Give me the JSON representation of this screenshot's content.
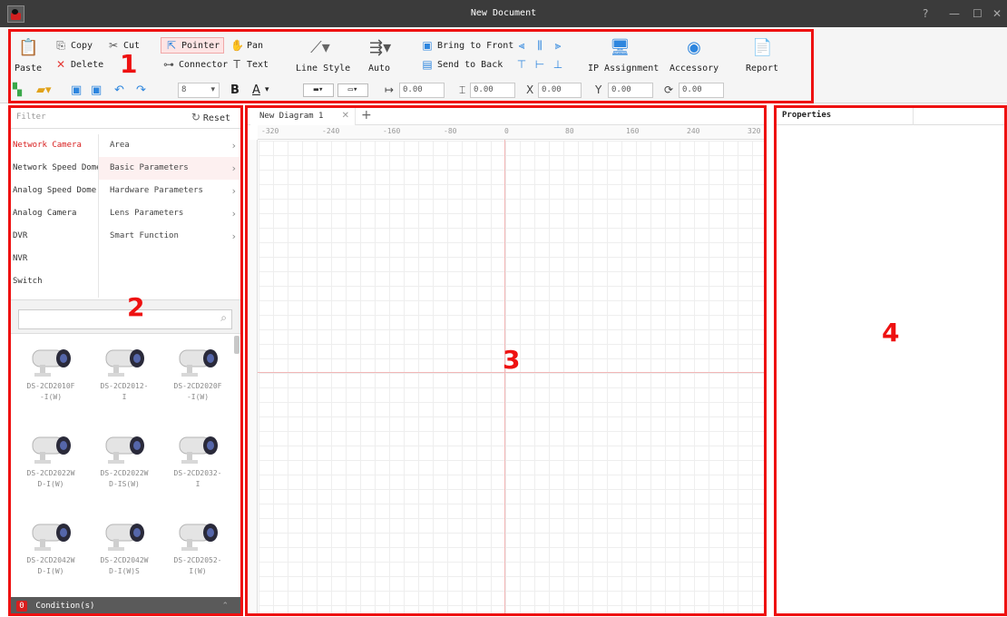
{
  "window": {
    "title": "New Document",
    "controls": [
      "?",
      "—",
      "☐",
      "✕"
    ]
  },
  "toolbar": {
    "paste": "Paste",
    "copy": "Copy",
    "cut": "Cut",
    "delete": "Delete",
    "pointer": "Pointer",
    "pan": "Pan",
    "connector": "Connector",
    "text": "Text",
    "line_style": "Line Style",
    "auto": "Auto",
    "bring_to_front": "Bring to Front",
    "send_to_back": "Send to Back",
    "ip_assignment": "IP Assignment",
    "accessory": "Accessory",
    "report": "Report",
    "font_size": "8",
    "bold": "B",
    "font_color": "A",
    "width_value": "0.00",
    "height_value": "0.00",
    "x_label": "X",
    "x_value": "0.00",
    "y_label": "Y",
    "y_value": "0.00",
    "rotation_value": "0.00"
  },
  "library": {
    "filter_placeholder": "Filter",
    "reset": "Reset",
    "categories": [
      "Network Camera",
      "Network Speed Dome",
      "Analog Speed Dome",
      "Analog Camera",
      "DVR",
      "NVR",
      "Switch"
    ],
    "selected_category": "Network Camera",
    "subcategories": [
      "Area",
      "Basic Parameters",
      "Hardware Parameters",
      "Lens Parameters",
      "Smart Function"
    ],
    "search_value": "",
    "devices": [
      "DS-2CD2010F\n-I(W)",
      "DS-2CD2012-\nI",
      "DS-2CD2020F\n-I(W)",
      "DS-2CD2022W\nD-I(W)",
      "DS-2CD2022W\nD-IS(W)",
      "DS-2CD2032-\nI",
      "DS-2CD2042W\nD-I(W)",
      "DS-2CD2042W\nD-I(W)S",
      "DS-2CD2052-\nI(W)"
    ],
    "condition_count": "0",
    "condition_label": "Condition(s)"
  },
  "canvas": {
    "tab_title": "New Diagram 1",
    "ruler_ticks": [
      "-320",
      "-240",
      "-160",
      "-80",
      "0",
      "80",
      "160",
      "240",
      "320"
    ]
  },
  "properties": {
    "title": "Properties"
  },
  "annotations": [
    "1",
    "2",
    "3",
    "4"
  ],
  "colors": {
    "accent_red": "#ee1111",
    "selected_text": "#d81e1e",
    "titlebar": "#3b3b3b",
    "icon_blue": "#2e86de"
  }
}
